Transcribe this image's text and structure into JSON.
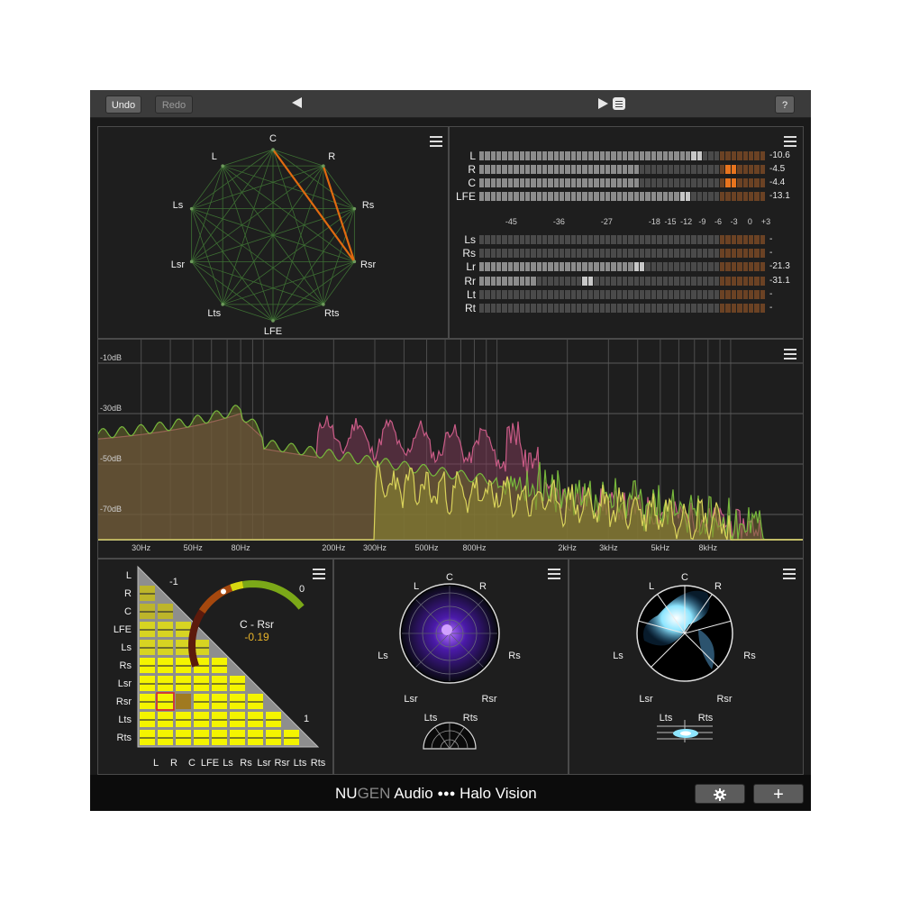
{
  "toolbar": {
    "undo_label": "Undo",
    "redo_label": "Redo",
    "help_label": "?"
  },
  "panels": {
    "vectorscope": {
      "channels": [
        "C",
        "R",
        "Rs",
        "Rsr",
        "Rts",
        "LFE",
        "Lts",
        "Lsr",
        "Ls",
        "L"
      ],
      "active_pairs": [
        [
          "C",
          "Rsr"
        ],
        [
          "R",
          "Rsr"
        ]
      ],
      "line_color": "#3d6e33",
      "active_color": "#e06a10"
    },
    "meters": {
      "group1": [
        {
          "label": "L",
          "value_text": "-10.6",
          "level": -10.6,
          "peak": -10.6
        },
        {
          "label": "R",
          "value_text": "-4.5",
          "level": -21,
          "peak": -4.5
        },
        {
          "label": "C",
          "value_text": "-4.4",
          "level": -21,
          "peak": -4.4
        },
        {
          "label": "LFE",
          "value_text": "-13.1",
          "level": -13.1,
          "peak": -13.1
        }
      ],
      "scale": [
        "-45",
        "-36",
        "-27",
        "-18",
        "-15",
        "-12",
        "-9",
        "-6",
        "-3",
        "0",
        "+3"
      ],
      "group2": [
        {
          "label": "Ls",
          "value_text": "-",
          "level": null,
          "peak": null
        },
        {
          "label": "Rs",
          "value_text": "-",
          "level": null,
          "peak": null
        },
        {
          "label": "Lr",
          "value_text": "-21.3",
          "level": -21.3,
          "peak": -21.3
        },
        {
          "label": "Rr",
          "value_text": "-31.1",
          "level": -41,
          "peak": -31.1
        },
        {
          "label": "Lt",
          "value_text": "-",
          "level": null,
          "peak": null
        },
        {
          "label": "Rt",
          "value_text": "-",
          "level": null,
          "peak": null
        }
      ],
      "colors": {
        "segment_off": "#4a4a4a",
        "segment_on": "#8c8c8c",
        "hot_off": "#6b4224",
        "hot_on": "#e8741e"
      }
    },
    "spectrum": {
      "db_labels": [
        "-10dB",
        "-30dB",
        "-50dB",
        "-70dB"
      ],
      "freq_labels": [
        "30Hz",
        "50Hz",
        "80Hz",
        "200Hz",
        "300Hz",
        "500Hz",
        "800Hz",
        "2kHz",
        "3kHz",
        "5kHz",
        "8kHz"
      ],
      "colors": {
        "green": "#77b83c",
        "pink": "#c95b86",
        "yellow": "#d9d35a",
        "fill": "#6b6a2c"
      }
    },
    "correlation": {
      "rows": [
        "L",
        "R",
        "C",
        "LFE",
        "Ls",
        "Rs",
        "Lsr",
        "Rsr",
        "Lts",
        "Rts"
      ],
      "cols": [
        "L",
        "R",
        "C",
        "LFE",
        "Ls",
        "Rs",
        "Lsr",
        "Rsr",
        "Lts",
        "Rts"
      ],
      "selected_pair": "C - Rsr",
      "selected_value": "-0.19",
      "correlation": -0.19,
      "gauge_labels": {
        "min": "-1",
        "mid": "0",
        "max": "1"
      }
    },
    "halo1": {
      "labels": [
        "C",
        "L",
        "R",
        "Ls",
        "Rs",
        "Lsr",
        "Rsr",
        "Lts",
        "Rts"
      ],
      "color": "#7a3cf0"
    },
    "halo2": {
      "labels": [
        "C",
        "L",
        "R",
        "Ls",
        "Rs",
        "Lsr",
        "Rsr",
        "Lts",
        "Rts"
      ],
      "color": "#8ee6ff"
    }
  },
  "footer": {
    "brand_nu": "NU",
    "brand_gen": "GEN",
    "brand_audio": " Audio ",
    "brand_dots": "●●●",
    "brand_product": " Halo Vision",
    "settings_icon": "gear-icon",
    "add_label": "+"
  }
}
